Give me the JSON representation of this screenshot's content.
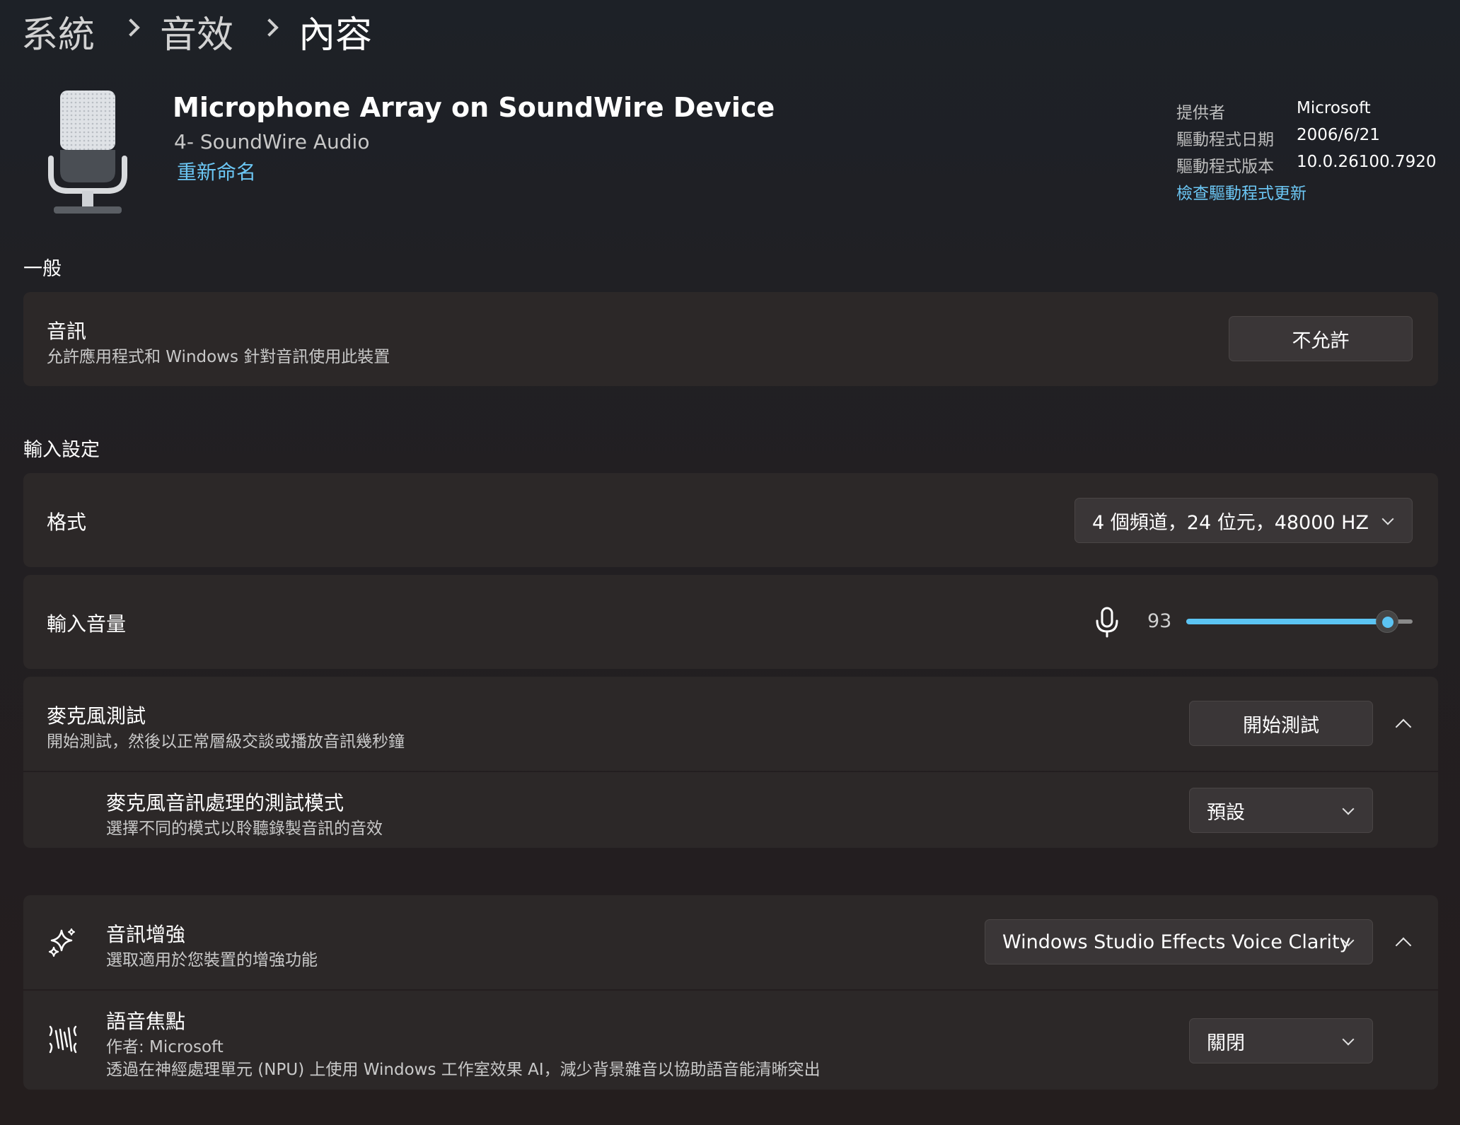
{
  "breadcrumb": {
    "item1": "系統",
    "item2": "音效",
    "current": "內容"
  },
  "device": {
    "name": "Microphone Array on SoundWire Device",
    "subtitle": "4- SoundWire Audio",
    "rename_link": "重新命名",
    "icon": "microphone-device-icon",
    "info": {
      "provider_label": "提供者",
      "provider_value": "Microsoft",
      "date_label": "驅動程式日期",
      "date_value": "2006/6/21",
      "version_label": "驅動程式版本",
      "version_value": "10.0.26100.7920",
      "update_link": "檢查驅動程式更新"
    }
  },
  "general": {
    "section_title": "一般",
    "audio": {
      "label": "音訊",
      "description": "允許應用程式和 Windows 針對音訊使用此裝置",
      "button": "不允許"
    }
  },
  "input_settings": {
    "section_title": "輸入設定",
    "format": {
      "label": "格式",
      "value": "4 個頻道，24 位元，48000 HZ"
    },
    "volume": {
      "label": "輸入音量",
      "value": "93",
      "level_percent": 93,
      "icon": "microphone-icon"
    },
    "mic_test": {
      "label": "麥克風測試",
      "description": "開始測試，然後以正常層級交談或播放音訊幾秒鐘",
      "button": "開始測試",
      "processing_mode": {
        "label": "麥克風音訊處理的測試模式",
        "description": "選擇不同的模式以聆聽錄製音訊的音效",
        "value": "預設"
      }
    }
  },
  "enhancements": {
    "label": "音訊增強",
    "description": "選取適用於您裝置的增強功能",
    "value": "Windows Studio Effects Voice Clarity",
    "icon": "sparkle-icon",
    "voice_focus": {
      "label": "語音焦點",
      "author": "作者: Microsoft",
      "description": "透過在神經處理單元 (NPU) 上使用 Windows 工作室效果 AI，減少背景雜音以協助語音能清晰突出",
      "value": "關閉",
      "icon": "voice-focus-icon"
    }
  },
  "colors": {
    "accent": "#5cc4f3",
    "link": "#6cc7f5",
    "card": "#2c2828"
  }
}
